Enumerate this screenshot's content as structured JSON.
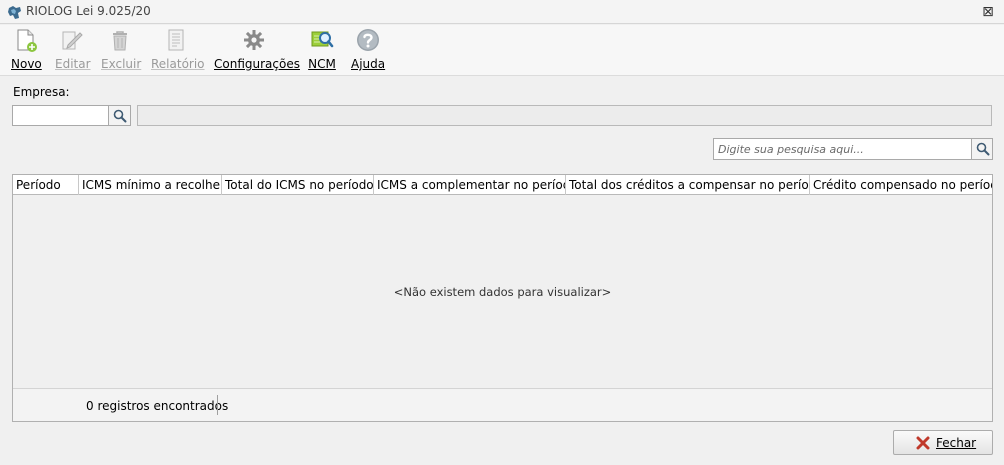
{
  "window": {
    "title": "RIOLOG Lei 9.025/20",
    "close_symbol": "⊠"
  },
  "toolbar": {
    "novo": "Novo",
    "editar": "Editar",
    "excluir": "Excluir",
    "relatorio": "Relatório",
    "configuracoes": "Configurações",
    "ncm": "NCM",
    "ajuda": "Ajuda"
  },
  "empresa": {
    "label": "Empresa:",
    "code_value": "",
    "name_value": ""
  },
  "search": {
    "placeholder": "Digite sua pesquisa aqui..."
  },
  "grid": {
    "columns": [
      "Período",
      "ICMS mínimo a recolher",
      "Total do ICMS no período",
      "ICMS a complementar no período",
      "Total dos créditos a compensar no período",
      "Crédito compensado no período"
    ],
    "empty_message": "<Não existem dados para visualizar>",
    "footer": "0 registros encontrados"
  },
  "actions": {
    "fechar": "Fechar"
  },
  "icons": [
    "app-icon",
    "new-document-icon",
    "edit-icon",
    "trash-icon",
    "report-icon",
    "gear-icon",
    "ncm-search-icon",
    "help-icon",
    "search-icon",
    "close-icon"
  ],
  "colors": {
    "accent_green": "#8cc63f",
    "help_gray": "#9aa3ab",
    "disabled_text": "#9a9a9a",
    "close_red": "#c0392b"
  }
}
